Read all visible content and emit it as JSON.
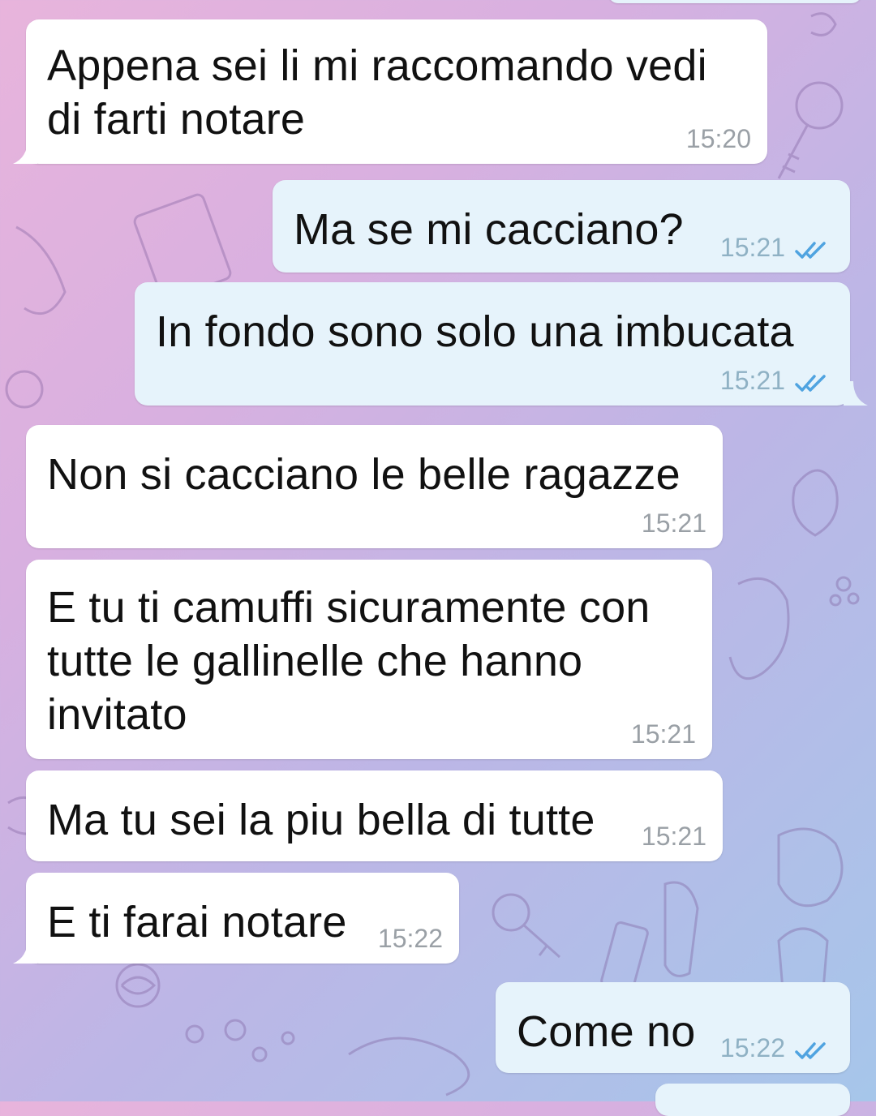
{
  "chat": {
    "messages": [
      {
        "direction": "in",
        "text": "Appena sei li mi raccomando vedi\ndi farti notare",
        "time": "15:20"
      },
      {
        "direction": "out",
        "text": "Ma se mi cacciano?",
        "time": "15:21",
        "status": "read"
      },
      {
        "direction": "out",
        "text": "In fondo sono solo una imbucata",
        "time": "15:21",
        "status": "read"
      },
      {
        "direction": "in",
        "text": "Non si cacciano le belle ragazze",
        "time": "15:21"
      },
      {
        "direction": "in",
        "text": "E tu ti camuffi sicuramente con\ntutte le gallinelle che hanno\ninvitato",
        "time": "15:21"
      },
      {
        "direction": "in",
        "text": "Ma tu sei la piu bella di tutte",
        "time": "15:21"
      },
      {
        "direction": "in",
        "text": "E ti farai notare",
        "time": "15:22"
      },
      {
        "direction": "out",
        "text": "Come no",
        "time": "15:22",
        "status": "read"
      }
    ]
  },
  "icons": {
    "read_check": "double-check-icon",
    "wallpaper": "doodle-pattern"
  },
  "colors": {
    "incoming_bubble": "#ffffff",
    "outgoing_bubble": "#e6f3fb",
    "read_check": "#4fa3e0",
    "timestamp": "#9aa0a6"
  }
}
